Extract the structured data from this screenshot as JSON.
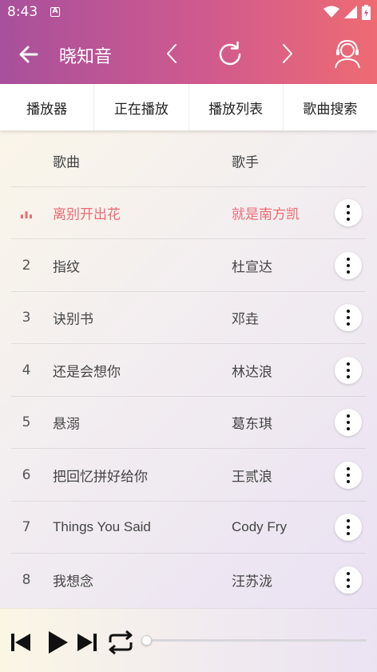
{
  "status_bar": {
    "time": "8:43",
    "notification_glyph": "A",
    "icons": [
      "wifi-icon",
      "cell-signal-icon",
      "battery-charging-icon"
    ]
  },
  "app_bar": {
    "title": "晓知音",
    "icons": [
      "back-arrow-icon",
      "chevron-left-icon",
      "refresh-icon",
      "chevron-right-icon",
      "user-service-icon"
    ]
  },
  "tabs": [
    {
      "label": "播放器"
    },
    {
      "label": "正在播放"
    },
    {
      "label": "播放列表"
    },
    {
      "label": "歌曲搜索"
    }
  ],
  "song_list": {
    "header": {
      "song": "歌曲",
      "artist": "歌手"
    },
    "rows": [
      {
        "num": "",
        "song": "离别开出花",
        "artist": "就是南方凯",
        "playing": true
      },
      {
        "num": "2",
        "song": "指纹",
        "artist": "杜宣达",
        "playing": false
      },
      {
        "num": "3",
        "song": "诀别书",
        "artist": "邓垚",
        "playing": false
      },
      {
        "num": "4",
        "song": "还是会想你",
        "artist": "林达浪",
        "playing": false
      },
      {
        "num": "5",
        "song": "悬溺",
        "artist": "葛东琪",
        "playing": false
      },
      {
        "num": "6",
        "song": "把回忆拼好给你",
        "artist": "王贰浪",
        "playing": false
      },
      {
        "num": "7",
        "song": "Things You Said",
        "artist": "Cody Fry",
        "playing": false
      },
      {
        "num": "8",
        "song": "我想念",
        "artist": "汪苏泷",
        "playing": false
      }
    ],
    "active_color": "#ee6b73"
  },
  "player": {
    "icons": [
      "skip-previous-icon",
      "play-icon",
      "skip-next-icon",
      "repeat-icon"
    ],
    "progress_fraction": 0.0
  },
  "colors": {
    "header_start": "#a8509c",
    "header_end": "#ee6b73",
    "accent": "#ee6b73"
  }
}
